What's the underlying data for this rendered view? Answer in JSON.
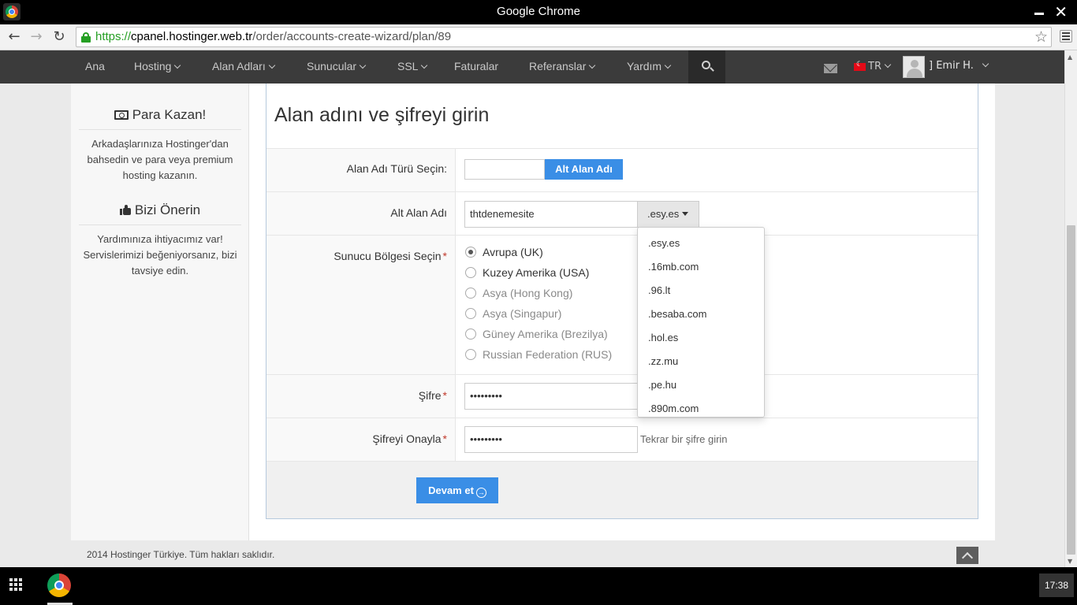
{
  "window": {
    "title": "Google Chrome",
    "close_glyph": "✕"
  },
  "browser": {
    "url_scheme": "https://",
    "url_host": "cpanel.hostinger.web.tr",
    "url_path": "/order/accounts-create-wizard/plan/89",
    "back_glyph": "←",
    "forward_glyph": "→",
    "reload_glyph": "↻",
    "star_glyph": "☆"
  },
  "nav": {
    "items": [
      "Ana",
      "Hosting",
      "Alan Adları",
      "Sunucular",
      "SSL",
      "Faturalar",
      "Referanslar",
      "Yardım"
    ],
    "lang": "TR",
    "username": "] Emir H."
  },
  "sidebar": {
    "earn_title": "Para Kazan!",
    "earn_text": "Arkadaşlarınıza Hostinger'dan bahsedin ve para veya premium hosting kazanın.",
    "recommend_title": "Bizi Önerin",
    "recommend_text": "Yardımınıza ihtiyacımız var! Servislerimizi beğeniyorsanız, bizi tavsiye edin."
  },
  "form": {
    "title": "Alan adını ve şifreyi girin",
    "domain_type_label": "Alan Adı Türü Seçin:",
    "domain_type_button": "Alt Alan Adı",
    "subdomain_label": "Alt Alan Adı",
    "subdomain_value": "thtdenemesite",
    "subdomain_suffix": ".esy.es",
    "region_label": "Sunucu Bölgesi Seçin",
    "regions": [
      "Avrupa (UK)",
      "Kuzey Amerika (USA)",
      "Asya (Hong Kong)",
      "Asya (Singapur)",
      "Güney Amerika (Brezilya)",
      "Russian Federation (RUS)"
    ],
    "password_label": "Şifre",
    "password_value": "•••••••••",
    "confirm_label": "Şifreyi Onayla",
    "confirm_value": "•••••••••",
    "confirm_hint": "Tekrar bir şifre girin",
    "required_mark": "*",
    "submit_label": "Devam et",
    "submit_arrow": "→"
  },
  "dropdown": {
    "options": [
      ".esy.es",
      ".16mb.com",
      ".96.lt",
      ".besaba.com",
      ".hol.es",
      ".zz.mu",
      ".pe.hu",
      ".890m.com"
    ]
  },
  "footer": {
    "copyright": "2014 Hostinger Türkiye. Tüm hakları saklıdır."
  },
  "taskbar": {
    "clock": "17:38"
  },
  "colors": {
    "accent": "#3a8ee6",
    "navbar": "#3b3b3b",
    "secure": "#259f23"
  }
}
